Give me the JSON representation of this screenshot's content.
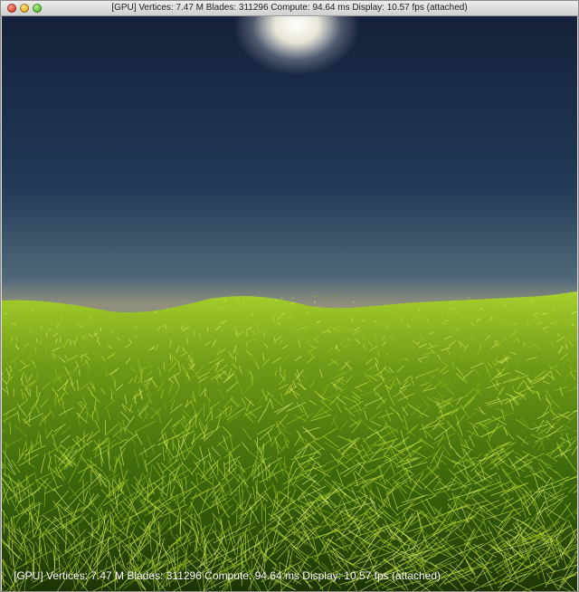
{
  "window": {
    "title": "[GPU] Vertices: 7.47 M  Blades: 311296  Compute: 94.64 ms  Display: 10.57 fps (attached)",
    "buttons": [
      "close",
      "minimize",
      "zoom"
    ]
  },
  "viewport": {
    "overlay_text": "[GPU] Vertices: 7.47 M  Blades: 311296  Compute: 94.64 ms  Display: 10.57 fps (attached)",
    "scene": {
      "sky_top_color": "#15213a",
      "sky_horizon_color": "#6f8590",
      "haze_color": "#c9b27a",
      "sun_color": "#ffffff",
      "grass_light_color": "#d6ef4a",
      "grass_mid_color": "#8fb51e",
      "grass_dark_color": "#1f3a06"
    }
  }
}
